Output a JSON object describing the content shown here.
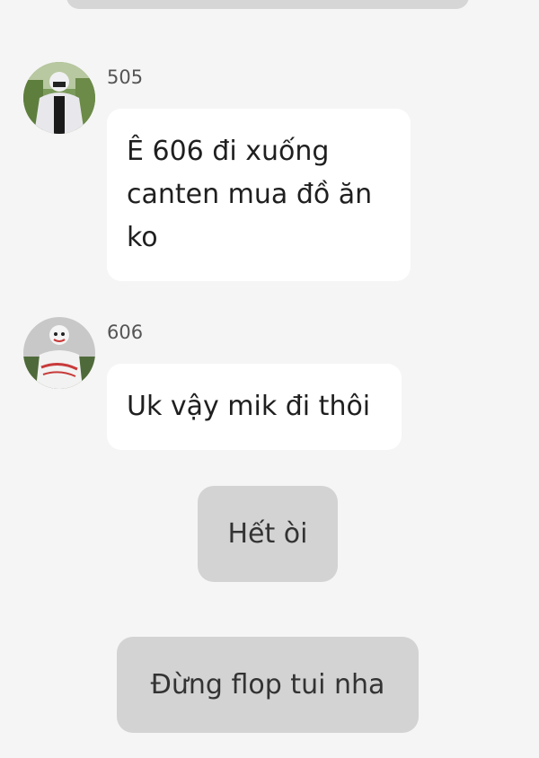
{
  "colors": {
    "background": "#f5f5f5",
    "bubble": "#ffffff",
    "choice_button": "#d3d3d3",
    "text": "#1f1f1f",
    "sender_text": "#555555"
  },
  "messages": [
    {
      "sender": "505",
      "avatar_icon": "person-in-white-hoodie-avatar",
      "text": "Ê 606 đi xuống\ncanten mua đồ ăn\nko"
    },
    {
      "sender": "606",
      "avatar_icon": "person-with-mask-avatar",
      "text": "Uk vậy mik đi thôi"
    }
  ],
  "choices": [
    {
      "label": "Hết òi"
    },
    {
      "label": "Đừng flop tui nha"
    }
  ]
}
